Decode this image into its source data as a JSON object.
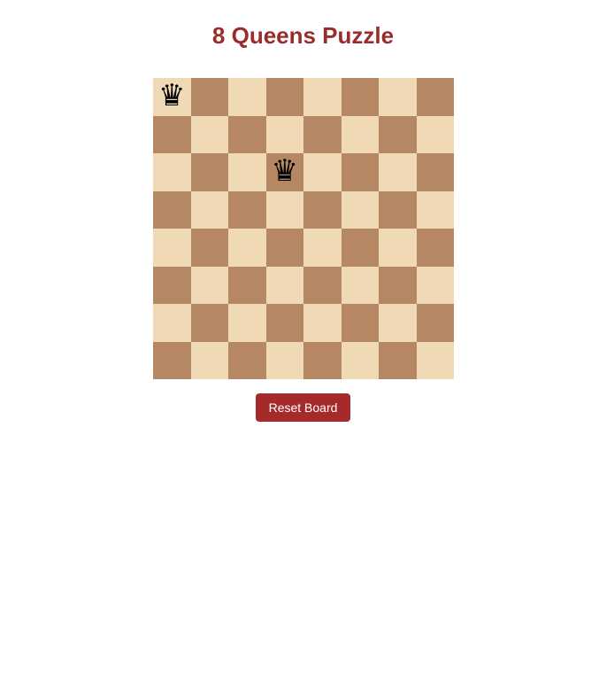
{
  "page": {
    "title": "8 Queens Puzzle"
  },
  "board": {
    "size": 8,
    "queen_glyph": "♛",
    "queens": [
      {
        "row": 0,
        "col": 0
      },
      {
        "row": 2,
        "col": 3
      }
    ]
  },
  "controls": {
    "reset_label": "Reset Board"
  },
  "colors": {
    "title": "#9b2c2c",
    "light_square": "#f0d9b5",
    "dark_square": "#b58863",
    "button_bg": "#a52a2a",
    "button_text": "#ffffff"
  }
}
